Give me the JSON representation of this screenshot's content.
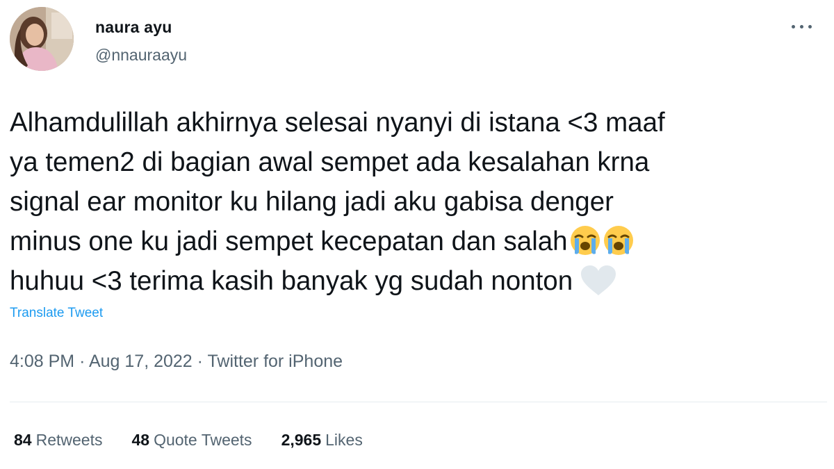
{
  "user": {
    "display_name": "naura ayu",
    "handle": "@nnauraayu"
  },
  "tweet": {
    "lines": [
      "Alhamdulillah akhirnya selesai nyanyi di istana <3 maaf",
      "ya temen2 di bagian awal sempet ada kesalahan krna",
      "signal ear monitor ku hilang jadi aku gabisa denger",
      "minus one ku jadi sempet kecepatan dan salah",
      "huhuu <3 terima kasih banyak yg sudah nonton"
    ],
    "emoji_line4": [
      "loudly-crying-face-icon",
      "loudly-crying-face-icon"
    ],
    "emoji_line5": "white-heart-icon"
  },
  "translate_label": "Translate Tweet",
  "meta": {
    "time": "4:08 PM",
    "date": "Aug 17, 2022",
    "source": "Twitter for iPhone",
    "separator": "·"
  },
  "stats": {
    "retweets": {
      "count": "84",
      "label": "Retweets"
    },
    "quote_tweets": {
      "count": "48",
      "label": "Quote Tweets"
    },
    "likes": {
      "count": "2,965",
      "label": "Likes"
    }
  },
  "colors": {
    "link": "#1d9bf0",
    "secondary_text": "#536471",
    "primary_text": "#0f1419"
  }
}
